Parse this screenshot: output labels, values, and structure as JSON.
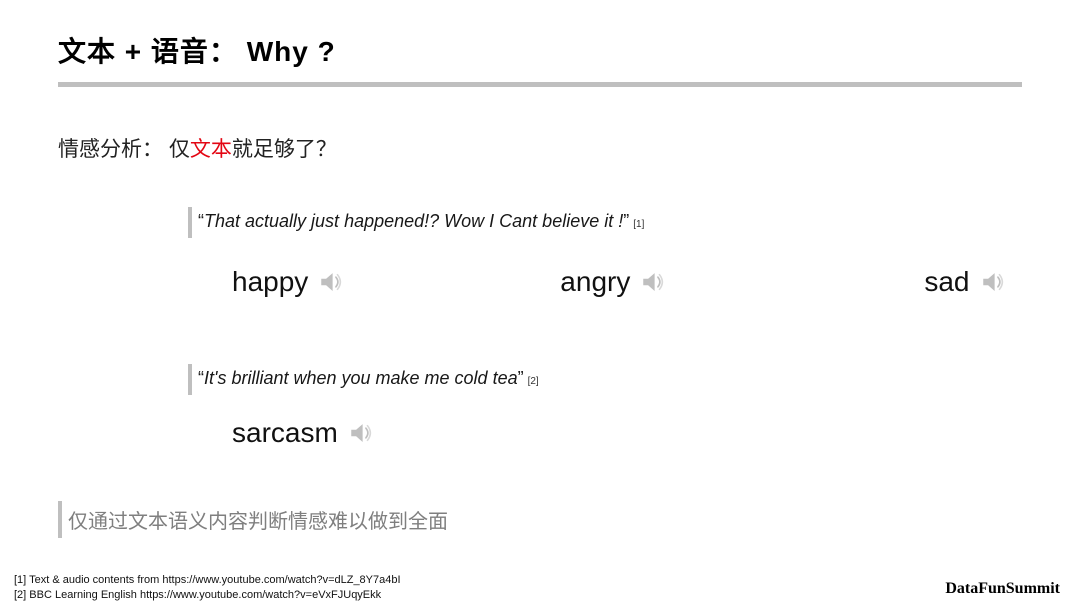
{
  "title": "文本 + 语音： Why ?",
  "subtitle": {
    "prefix": "情感分析：  仅",
    "highlight": "文本",
    "suffix": "就足够了？"
  },
  "quote1": {
    "open": "“",
    "text": "That actually just happened!? Wow I Cant believe it !",
    "close": "”",
    "ref": "[1]"
  },
  "emotions1": {
    "happy": "happy",
    "angry": "angry",
    "sad": "sad"
  },
  "quote2": {
    "open": "“",
    "text": "It's brilliant when you make me cold tea",
    "close": "”",
    "ref": "[2]"
  },
  "emotions2": {
    "sarcasm": "sarcasm"
  },
  "conclusion": "仅通过文本语义内容判断情感难以做到全面",
  "refs": {
    "r1": "[1] Text & audio contents from https://www.youtube.com/watch?v=dLZ_8Y7a4bI",
    "r2": "[2] BBC Learning English https://www.youtube.com/watch?v=eVxFJUqyEkk"
  },
  "brand": "DataFunSummit"
}
